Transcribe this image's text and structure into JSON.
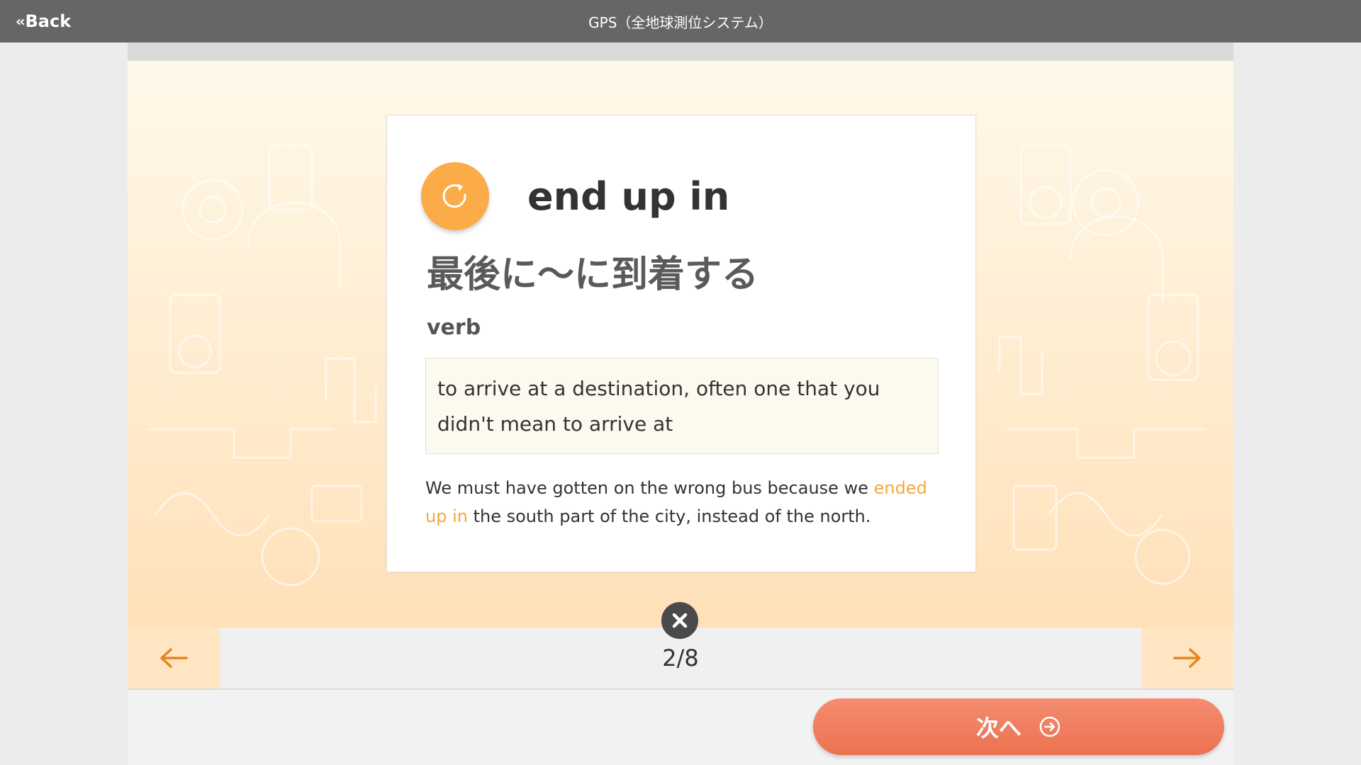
{
  "topbar": {
    "back_label": "Back",
    "title": "GPS（全地球測位システム）"
  },
  "card": {
    "term": "end up in",
    "translation": "最後に～に到着する",
    "part_of_speech": "verb",
    "definition": "to arrive at a destination, often one that you didn't mean to arrive at",
    "example_before": "We must have gotten on the wrong bus because we ",
    "example_highlight": "ended up in",
    "example_after": " the south part of the city, instead of the north."
  },
  "nav": {
    "counter": "2/8"
  },
  "next_button": {
    "label": "次へ"
  },
  "colors": {
    "topbar": "#666666",
    "accent_orange": "#fbab47",
    "highlight": "#f7a63a",
    "next_button": "#ee7a5a",
    "arrow": "#e8841c"
  },
  "icons": {
    "back": "double-chevron-left-icon",
    "flip": "refresh-icon",
    "close": "close-icon",
    "prev": "arrow-left-icon",
    "next": "arrow-right-icon",
    "next_button": "circle-arrow-right-icon"
  }
}
